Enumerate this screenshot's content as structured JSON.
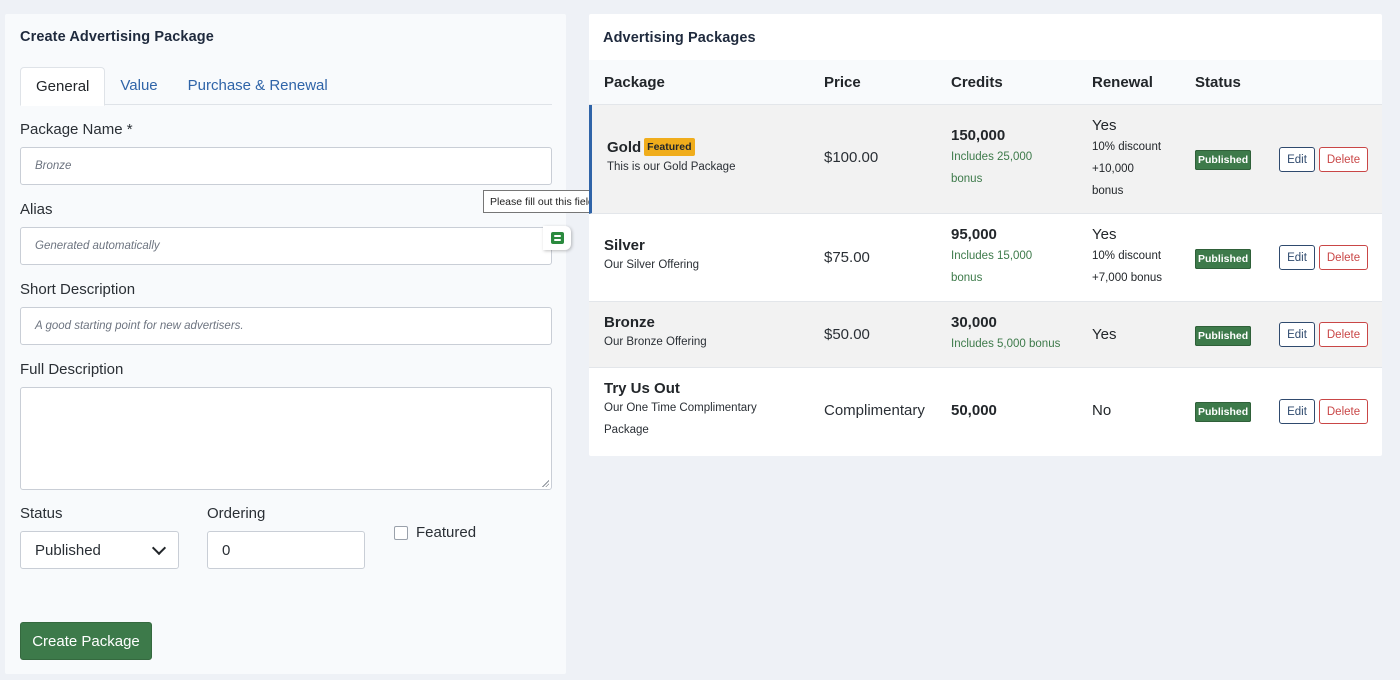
{
  "form": {
    "title": "Create Advertising Package",
    "tabs": [
      {
        "label": "General"
      },
      {
        "label": "Value"
      },
      {
        "label": "Purchase & Renewal"
      }
    ],
    "package_name": {
      "label": "Package Name *",
      "placeholder": "Bronze"
    },
    "alias": {
      "label": "Alias",
      "placeholder": "Generated automatically"
    },
    "short_description": {
      "label": "Short Description",
      "placeholder": "A good starting point for new advertisers."
    },
    "full_description": {
      "label": "Full Description",
      "value": ""
    },
    "status": {
      "label": "Status",
      "value": "Published"
    },
    "ordering": {
      "label": "Ordering",
      "value": "0"
    },
    "featured": {
      "label": "Featured",
      "checked": false
    },
    "submit_label": "Create Package",
    "tooltip": "Please fill out this field."
  },
  "packages": {
    "title": "Advertising Packages",
    "columns": [
      "Package",
      "Price",
      "Credits",
      "Renewal",
      "Status"
    ],
    "featured_badge": "Featured",
    "edit_label": "Edit",
    "delete_label": "Delete",
    "rows": [
      {
        "name": "Gold",
        "description": "This is our Gold Package",
        "featured": true,
        "price": "$100.00",
        "credits": "150,000",
        "bonus_lines": [
          "Includes 25,000",
          "bonus"
        ],
        "renewal": "Yes",
        "renewal_lines": [
          "10% discount",
          "+10,000",
          "bonus"
        ],
        "status": "Published"
      },
      {
        "name": "Silver",
        "description": "Our Silver Offering",
        "featured": false,
        "price": "$75.00",
        "credits": "95,000",
        "bonus_lines": [
          "Includes 15,000",
          "bonus"
        ],
        "renewal": "Yes",
        "renewal_lines": [
          "10% discount",
          "+7,000 bonus"
        ],
        "status": "Published"
      },
      {
        "name": "Bronze",
        "description": "Our Bronze Offering",
        "featured": false,
        "price": "$50.00",
        "credits": "30,000",
        "bonus_lines": [
          "Includes 5,000 bonus"
        ],
        "renewal": "Yes",
        "renewal_lines": [],
        "status": "Published"
      },
      {
        "name": "Try Us Out",
        "description_lines": [
          "Our One Time Complimentary",
          "Package"
        ],
        "featured": false,
        "price": "Complimentary",
        "credits": "50,000",
        "bonus_lines": [],
        "renewal": "No",
        "renewal_lines": [],
        "status": "Published"
      }
    ]
  },
  "colors": {
    "accent_green": "#3d7a4a",
    "featured_badge": "#f0ad1c",
    "link_blue": "#2f64a8",
    "delete_red": "#c94646"
  }
}
